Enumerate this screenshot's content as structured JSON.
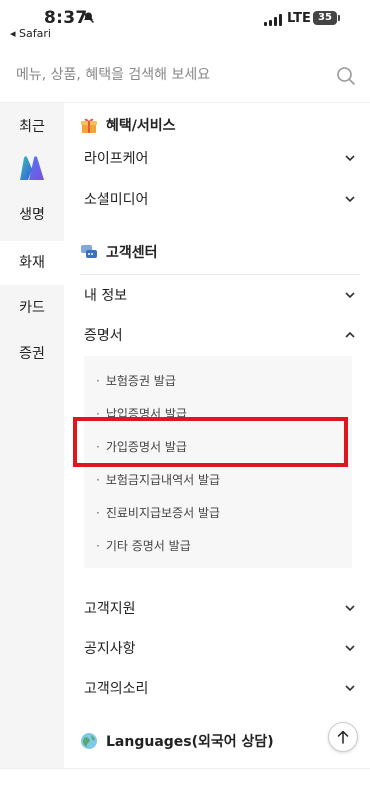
{
  "status": {
    "time": "8:37",
    "back_app": "◂ Safari",
    "network": "LTE",
    "battery": "35"
  },
  "search": {
    "placeholder": "메뉴, 상품, 혜택을 검색해 보세요"
  },
  "sidebar": {
    "items": [
      {
        "label": "최근"
      },
      {
        "label": "생명"
      },
      {
        "label": "화재"
      },
      {
        "label": "카드"
      },
      {
        "label": "증권"
      }
    ],
    "active": "화재"
  },
  "main": {
    "benefits": {
      "title": "혜택/서비스",
      "icon": "gift-icon"
    },
    "rows1": [
      {
        "label": "라이프케어"
      },
      {
        "label": "소셜미디어"
      }
    ],
    "customer_center": {
      "title": "고객센터",
      "icon": "chat-icon"
    },
    "rows2": [
      {
        "label": "내 정보"
      },
      {
        "label": "증명서"
      }
    ],
    "certificates": [
      {
        "label": "보험증권 발급"
      },
      {
        "label": "납입증명서 발급"
      },
      {
        "label": "가입증명서 발급"
      },
      {
        "label": "보험금지급내역서 발급"
      },
      {
        "label": "진료비지급보증서 발급"
      },
      {
        "label": "기타 증명서 발급"
      }
    ],
    "rows3": [
      {
        "label": "고객지원"
      },
      {
        "label": "공지사항"
      },
      {
        "label": "고객의소리"
      }
    ],
    "languages": {
      "title": "Languages(외국어 상담)",
      "icon": "globe-icon"
    }
  },
  "colors": {
    "highlight": "#e0161e",
    "sidebar_bg": "#f5f5f5",
    "accent": "#222222"
  }
}
